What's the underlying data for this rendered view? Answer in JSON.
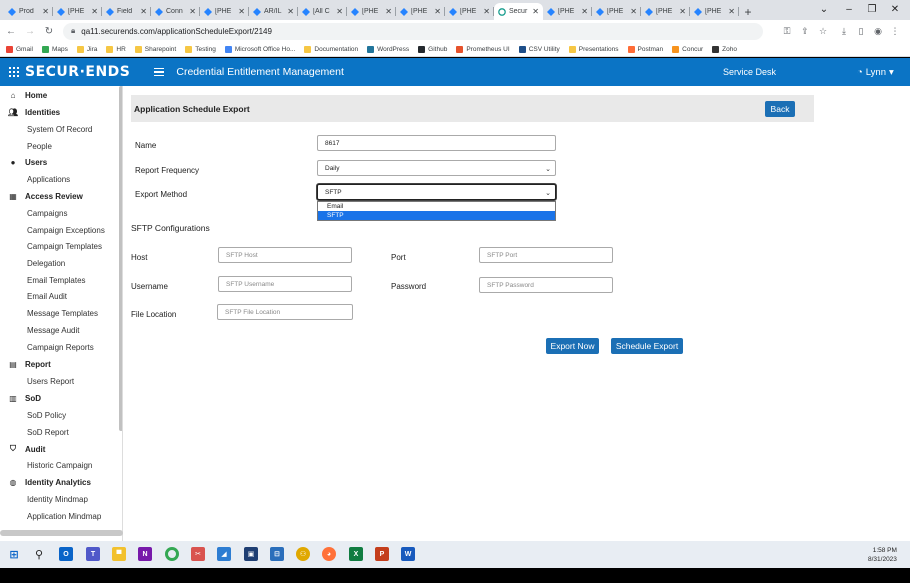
{
  "browser": {
    "tabs": [
      {
        "title": "Prod",
        "active": false
      },
      {
        "title": "[PHE",
        "active": false
      },
      {
        "title": "Field",
        "active": false
      },
      {
        "title": "Conn",
        "active": false
      },
      {
        "title": "[PHE",
        "active": false
      },
      {
        "title": "AR/IL",
        "active": false
      },
      {
        "title": "[All C",
        "active": false
      },
      {
        "title": "[PHE",
        "active": false
      },
      {
        "title": "[PHE",
        "active": false
      },
      {
        "title": "[PHE",
        "active": false
      },
      {
        "title": "Secur",
        "active": true
      },
      {
        "title": "[PHE",
        "active": false
      },
      {
        "title": "[PHE",
        "active": false
      },
      {
        "title": "[PHE",
        "active": false
      },
      {
        "title": "[PHE",
        "active": false
      }
    ],
    "url": "qa11.securends.com/applicationScheduleExport/2149",
    "bookmarks": [
      "Gmail",
      "Maps",
      "Jira",
      "HR",
      "Sharepoint",
      "Testing",
      "Microsoft Office Ho...",
      "Documentation",
      "WordPress",
      "Github",
      "Prometheus UI",
      "CSV Utility",
      "Presentations",
      "Postman",
      "Concur",
      "Zoho"
    ]
  },
  "app": {
    "brand": "SECUR·ENDS",
    "title": "Credential Entitlement Management",
    "service_desk": "Service Desk",
    "user": "Lynn"
  },
  "sidebar": {
    "home": "Home",
    "identities": "Identities",
    "identities_items": [
      "System Of Record",
      "People"
    ],
    "users": "Users",
    "users_items": [
      "Applications"
    ],
    "access_review": "Access Review",
    "access_review_items": [
      "Campaigns",
      "Campaign Exceptions",
      "Campaign Templates",
      "Delegation",
      "Email Templates",
      "Email Audit",
      "Message Templates",
      "Message Audit",
      "Campaign Reports"
    ],
    "report": "Report",
    "report_items": [
      "Users Report"
    ],
    "sod": "SoD",
    "sod_items": [
      "SoD Policy",
      "SoD Report"
    ],
    "audit": "Audit",
    "audit_items": [
      "Historic Campaign"
    ],
    "identity_analytics": "Identity Analytics",
    "identity_analytics_items": [
      "Identity Mindmap",
      "Application Mindmap"
    ]
  },
  "form": {
    "header": "Application Schedule Export",
    "back": "Back",
    "name_label": "Name",
    "name_value": "8617",
    "frequency_label": "Report Frequency",
    "frequency_value": "Daily",
    "method_label": "Export Method",
    "method_value": "SFTP",
    "method_options": [
      "Email",
      "SFTP"
    ],
    "sftp_title": "SFTP Configurations",
    "host_label": "Host",
    "host_placeholder": "SFTP Host",
    "port_label": "Port",
    "port_placeholder": "SFTP Port",
    "username_label": "Username",
    "username_placeholder": "SFTP Username",
    "password_label": "Password",
    "password_placeholder": "SFTP Password",
    "file_label": "File Location",
    "file_placeholder": "SFTP File Location",
    "export_now": "Export Now",
    "schedule_export": "Schedule Export"
  },
  "taskbar": {
    "time": "1:58 PM",
    "date": "8/31/2023"
  },
  "colors": {
    "header_blue": "#0b74c5",
    "button_blue": "#1b6fb5",
    "select_highlight": "#1a73e8"
  }
}
